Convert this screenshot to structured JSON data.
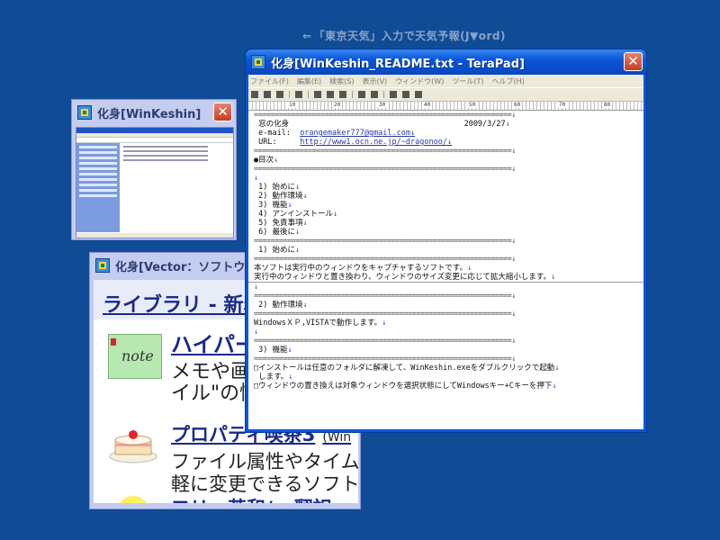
{
  "caption": {
    "arrow": "⇐",
    "text": "「東京天気」入力で天気予報(J▼ord)"
  },
  "windows": {
    "winkeshin": {
      "title": "化身[WinKeshin]",
      "close": "✕"
    },
    "vector": {
      "title": "化身[Vector：ソフトウェア",
      "close": "✕",
      "nav": "ライブラリ - 新着",
      "item1": {
        "icon_label": "note",
        "title": "ハイパー",
        "desc1": "メモや画像",
        "desc2": "イル\"の情報管理ソフト"
      },
      "item2": {
        "title": "プロパティ喫茶3",
        "suffix": "(Win",
        "desc1": "ファイル属性やタイムス",
        "desc2": "軽に変更できるソフト"
      },
      "item3": {
        "title": "フリー英和/...翻訳"
      }
    },
    "terapad": {
      "title": "化身[WinKeshin_README.txt - TeraPad]",
      "close": "✕",
      "menu": [
        "ファイル(F)",
        "編集(E)",
        "検索(S)",
        "表示(V)",
        "ウィンドウ(W)",
        "ツール(T)",
        "ヘルプ(H)"
      ],
      "ruler": [
        "10",
        "20",
        "30",
        "40",
        "50",
        "60",
        "70",
        "80"
      ],
      "lines": [
        {
          "t": "==============================================================",
          "nl": "↓",
          "k": "sep"
        },
        {
          "t": " 窓の化身                                      2009/3/27",
          "nl": "↓",
          "k": ""
        },
        {
          "t": " e-mail:  ",
          "u": "orangemaker777@gmail.com",
          "nl": "↓",
          "k": "link"
        },
        {
          "t": " URL:     ",
          "u": "http://www1.ocn.ne.jp/~dragonoo/",
          "nl": "↓",
          "k": "link"
        },
        {
          "t": "==============================================================",
          "nl": "↓",
          "k": "sep"
        },
        {
          "t": "●目次",
          "nl": "↓",
          "k": ""
        },
        {
          "t": "==============================================================",
          "nl": "↓",
          "k": "sep"
        },
        {
          "t": "",
          "nl": "↓",
          "k": ""
        },
        {
          "t": " 1) 始めに",
          "nl": "↓",
          "k": ""
        },
        {
          "t": " 2) 動作環境",
          "nl": "↓",
          "k": ""
        },
        {
          "t": " 3) 機能",
          "nl": "↓",
          "k": ""
        },
        {
          "t": " 4) アンインストール",
          "nl": "↓",
          "k": ""
        },
        {
          "t": " 5) 免責事項",
          "nl": "↓",
          "k": ""
        },
        {
          "t": " 6) 最後に",
          "nl": "↓",
          "k": ""
        },
        {
          "t": "==============================================================",
          "nl": "↓",
          "k": "sep"
        },
        {
          "t": " 1) 始めに",
          "nl": "↓",
          "k": ""
        },
        {
          "t": "==============================================================",
          "nl": "↓",
          "k": "sep"
        },
        {
          "t": "本ソフトは実行中のウィンドウをキャプチャするソフトです。",
          "nl": "↓",
          "k": ""
        },
        {
          "t": "実行中のウィンドウと置き換わり、ウィンドウのサイズ変更に応じて拡大縮小します。",
          "nl": "↓",
          "k": "cur"
        },
        {
          "t": "",
          "nl": "↓",
          "k": ""
        },
        {
          "t": "==============================================================",
          "nl": "↓",
          "k": "sep"
        },
        {
          "t": " 2) 動作環境",
          "nl": "↓",
          "k": ""
        },
        {
          "t": "==============================================================",
          "nl": "↓",
          "k": "sep"
        },
        {
          "t": "WindowsＸＰ,VISTAで動作します。",
          "nl": "↓",
          "k": ""
        },
        {
          "t": "",
          "nl": "↓",
          "k": ""
        },
        {
          "t": "==============================================================",
          "nl": "↓",
          "k": "sep"
        },
        {
          "t": " 3) 機能",
          "nl": "↓",
          "k": ""
        },
        {
          "t": "==============================================================",
          "nl": "↓",
          "k": "sep"
        },
        {
          "t": "□インストールは任意のフォルダに解凍して、WinKeshin.exeをダブルクリックで起動",
          "nl": "↓",
          "k": ""
        },
        {
          "t": " します。",
          "nl": "↓",
          "k": ""
        },
        {
          "t": "□ウィンドウの置き換えは対象ウィンドウを選択状態にしてWindowsキー+Cキーを押下",
          "nl": "↓",
          "k": ""
        }
      ]
    }
  }
}
